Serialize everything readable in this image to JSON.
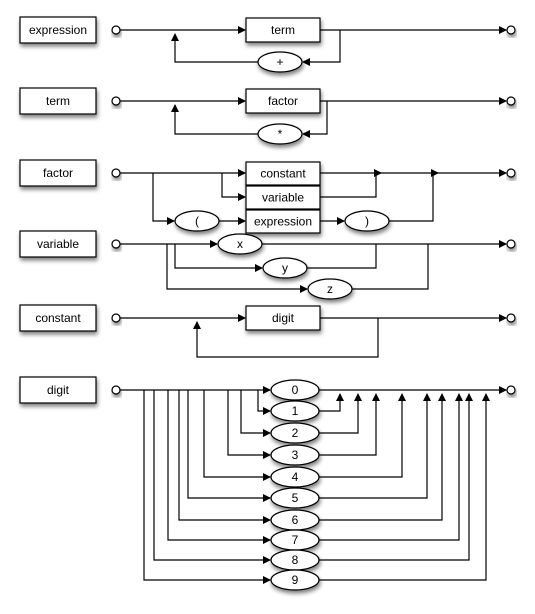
{
  "rules": [
    {
      "name": "expression",
      "items": [
        "term",
        "+"
      ]
    },
    {
      "name": "term",
      "items": [
        "factor",
        "*"
      ]
    },
    {
      "name": "factor",
      "items": [
        "constant",
        "variable",
        "(",
        "expression",
        ")"
      ]
    },
    {
      "name": "variable",
      "items": [
        "x",
        "y",
        "z"
      ]
    },
    {
      "name": "constant",
      "items": [
        "digit"
      ]
    },
    {
      "name": "digit",
      "items": [
        "0",
        "1",
        "2",
        "3",
        "4",
        "5",
        "6",
        "7",
        "8",
        "9"
      ]
    }
  ],
  "colors": {
    "stroke": "#000000",
    "fill": "#ffffff"
  }
}
